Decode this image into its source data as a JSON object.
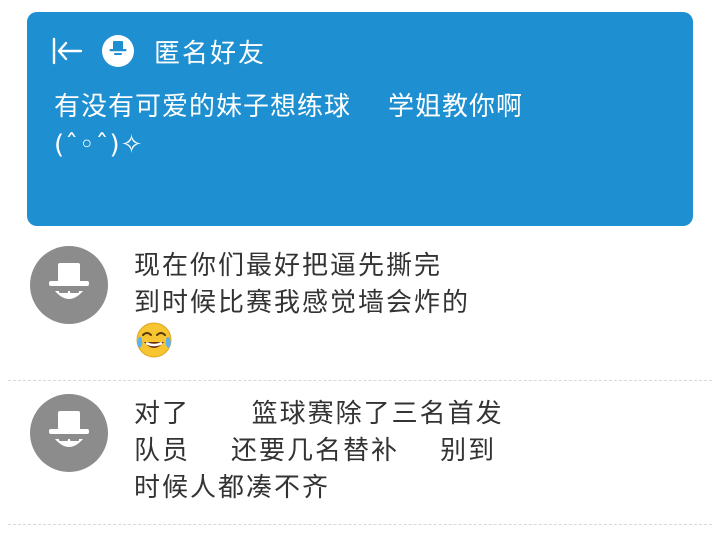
{
  "post": {
    "title": "匿名好友",
    "text": "有没有可爱的妹子想练球    学姐教你啊\n(ˆ◦ˆ)✧",
    "bubble_color": "#1e8fd0",
    "icons": [
      "back-arrow-icon",
      "anonymous-avatar-icon"
    ]
  },
  "comments": [
    {
      "text": "现在你们最好把逼先撕完\n到时候比赛我感觉墙会炸的",
      "emoji": "tears-of-joy-emoji-icon",
      "avatar": "anonymous-avatar-icon"
    },
    {
      "text": "对了      篮球赛除了三名首发\n队员    还要几名替补    别到\n时候人都凑不齐",
      "avatar": "anonymous-avatar-icon"
    }
  ],
  "colors": {
    "avatar_gray": "#8c8c8c",
    "text": "#333333"
  }
}
